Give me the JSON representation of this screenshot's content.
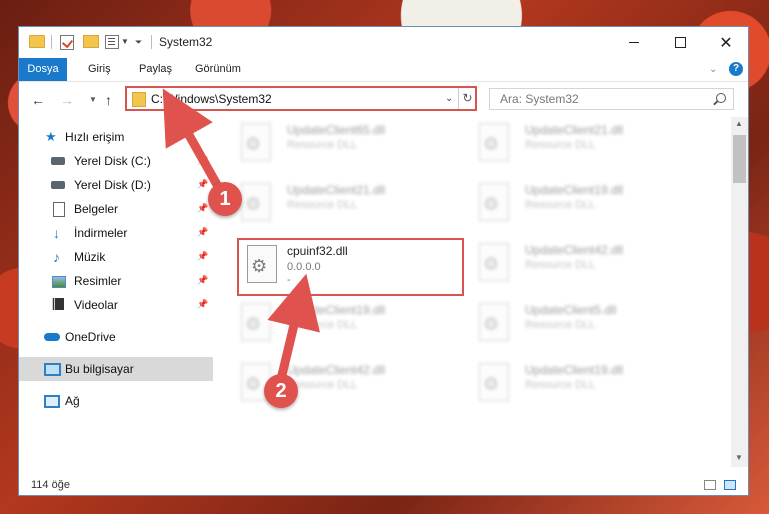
{
  "window": {
    "title": "System32",
    "controls": {
      "minimize": "",
      "maximize": "",
      "close": "✕"
    }
  },
  "ribbon": {
    "tabs": [
      "Dosya",
      "Giriş",
      "Paylaş",
      "Görünüm"
    ],
    "help": "?"
  },
  "nav": {
    "address": "C:\\Windows\\System32",
    "search_placeholder": "Ara: System32"
  },
  "sidebar": {
    "quick_access": "Hızlı erişim",
    "items": [
      {
        "label": "Yerel Disk (C:)",
        "icon": "disk-icon",
        "pinned": true
      },
      {
        "label": "Yerel Disk (D:)",
        "icon": "disk-icon",
        "pinned": true
      },
      {
        "label": "Belgeler",
        "icon": "documents-icon",
        "pinned": true
      },
      {
        "label": "İndirmeler",
        "icon": "downloads-icon",
        "pinned": true
      },
      {
        "label": "Müzik",
        "icon": "music-icon",
        "pinned": true
      },
      {
        "label": "Resimler",
        "icon": "pictures-icon",
        "pinned": true
      },
      {
        "label": "Videolar",
        "icon": "videos-icon",
        "pinned": true
      }
    ],
    "onedrive": "OneDrive",
    "this_pc": "Bu bilgisayar",
    "network": "Ağ"
  },
  "files": {
    "left": [
      {
        "name": "UpdateClient65.dll",
        "type": "Resource DLL"
      },
      {
        "name": "UpdateClient21.dll",
        "type": "Resource DLL"
      },
      {
        "name": "cpuinf32.dll",
        "version": "0.0.0.0",
        "extra": "-"
      },
      {
        "name": "UpdateClient19.dll",
        "type": "Resource DLL"
      },
      {
        "name": "UpdateClient42.dll",
        "type": "Resource DLL"
      }
    ],
    "right": [
      {
        "name": "UpdateClient21.dll",
        "type": "Resource DLL"
      },
      {
        "name": "UpdateClient19.dll",
        "type": "Resource DLL"
      },
      {
        "name": "UpdateClient42.dll",
        "type": "Resource DLL"
      },
      {
        "name": "UpdateClient5.dll",
        "type": "Resource DLL"
      },
      {
        "name": "UpdateClient19.dll",
        "type": "Resource DLL"
      }
    ]
  },
  "status": {
    "count": "114 öğe"
  },
  "callouts": [
    "1",
    "2"
  ],
  "colors": {
    "accent": "#1979ca",
    "highlight": "#d9534f",
    "callout": "#e0524d"
  }
}
